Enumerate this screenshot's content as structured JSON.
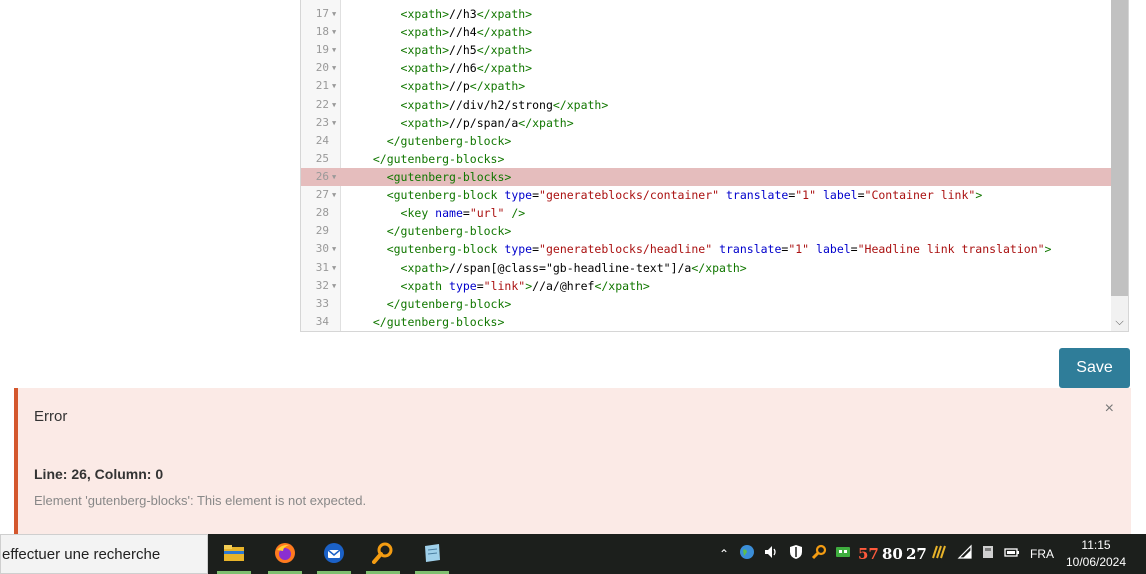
{
  "editor": {
    "lines": [
      {
        "num": "17",
        "fold": true,
        "error": false,
        "tokens": [
          [
            "x",
            "      "
          ],
          [
            "t",
            "<xpath>"
          ],
          [
            "x",
            "//h3"
          ],
          [
            "t",
            "</xpath>"
          ]
        ]
      },
      {
        "num": "18",
        "fold": true,
        "error": false,
        "tokens": [
          [
            "x",
            "      "
          ],
          [
            "t",
            "<xpath>"
          ],
          [
            "x",
            "//h4"
          ],
          [
            "t",
            "</xpath>"
          ]
        ]
      },
      {
        "num": "19",
        "fold": true,
        "error": false,
        "tokens": [
          [
            "x",
            "      "
          ],
          [
            "t",
            "<xpath>"
          ],
          [
            "x",
            "//h5"
          ],
          [
            "t",
            "</xpath>"
          ]
        ]
      },
      {
        "num": "20",
        "fold": true,
        "error": false,
        "tokens": [
          [
            "x",
            "      "
          ],
          [
            "t",
            "<xpath>"
          ],
          [
            "x",
            "//h6"
          ],
          [
            "t",
            "</xpath>"
          ]
        ]
      },
      {
        "num": "21",
        "fold": true,
        "error": false,
        "tokens": [
          [
            "x",
            "      "
          ],
          [
            "t",
            "<xpath>"
          ],
          [
            "x",
            "//p"
          ],
          [
            "t",
            "</xpath>"
          ]
        ]
      },
      {
        "num": "22",
        "fold": true,
        "error": false,
        "tokens": [
          [
            "x",
            "      "
          ],
          [
            "t",
            "<xpath>"
          ],
          [
            "x",
            "//div/h2/strong"
          ],
          [
            "t",
            "</xpath>"
          ]
        ]
      },
      {
        "num": "23",
        "fold": true,
        "error": false,
        "tokens": [
          [
            "x",
            "      "
          ],
          [
            "t",
            "<xpath>"
          ],
          [
            "x",
            "//p/span/a"
          ],
          [
            "t",
            "</xpath>"
          ]
        ]
      },
      {
        "num": "24",
        "fold": false,
        "error": false,
        "tokens": [
          [
            "x",
            "    "
          ],
          [
            "t",
            "</gutenberg-block>"
          ]
        ]
      },
      {
        "num": "25",
        "fold": false,
        "error": false,
        "tokens": [
          [
            "x",
            "  "
          ],
          [
            "t",
            "</gutenberg-blocks>"
          ]
        ]
      },
      {
        "num": "26",
        "fold": true,
        "error": true,
        "tokens": [
          [
            "x",
            "    "
          ],
          [
            "t",
            "<gutenberg-blocks>"
          ]
        ]
      },
      {
        "num": "27",
        "fold": true,
        "error": false,
        "tokens": [
          [
            "x",
            "    "
          ],
          [
            "t",
            "<gutenberg-block "
          ],
          [
            "a",
            "type"
          ],
          [
            "x",
            "="
          ],
          [
            "s",
            "\"generateblocks/container\""
          ],
          [
            "x",
            " "
          ],
          [
            "a",
            "translate"
          ],
          [
            "x",
            "="
          ],
          [
            "s",
            "\"1\""
          ],
          [
            "x",
            " "
          ],
          [
            "a",
            "label"
          ],
          [
            "x",
            "="
          ],
          [
            "s",
            "\"Container link\""
          ],
          [
            "t",
            ">"
          ]
        ]
      },
      {
        "num": "28",
        "fold": false,
        "error": false,
        "tokens": [
          [
            "x",
            "      "
          ],
          [
            "t",
            "<key "
          ],
          [
            "a",
            "name"
          ],
          [
            "x",
            "="
          ],
          [
            "s",
            "\"url\""
          ],
          [
            "x",
            " "
          ],
          [
            "t",
            "/>"
          ]
        ]
      },
      {
        "num": "29",
        "fold": false,
        "error": false,
        "tokens": [
          [
            "x",
            "    "
          ],
          [
            "t",
            "</gutenberg-block>"
          ]
        ]
      },
      {
        "num": "30",
        "fold": true,
        "error": false,
        "tokens": [
          [
            "x",
            "    "
          ],
          [
            "t",
            "<gutenberg-block "
          ],
          [
            "a",
            "type"
          ],
          [
            "x",
            "="
          ],
          [
            "s",
            "\"generateblocks/headline\""
          ],
          [
            "x",
            " "
          ],
          [
            "a",
            "translate"
          ],
          [
            "x",
            "="
          ],
          [
            "s",
            "\"1\""
          ],
          [
            "x",
            " "
          ],
          [
            "a",
            "label"
          ],
          [
            "x",
            "="
          ],
          [
            "s",
            "\"Headline link translation\""
          ],
          [
            "t",
            ">"
          ]
        ]
      },
      {
        "num": "31",
        "fold": true,
        "error": false,
        "tokens": [
          [
            "x",
            "      "
          ],
          [
            "t",
            "<xpath>"
          ],
          [
            "x",
            "//span[@class=\"gb-headline-text\"]/a"
          ],
          [
            "t",
            "</xpath>"
          ]
        ]
      },
      {
        "num": "32",
        "fold": true,
        "error": false,
        "tokens": [
          [
            "x",
            "      "
          ],
          [
            "t",
            "<xpath "
          ],
          [
            "a",
            "type"
          ],
          [
            "x",
            "="
          ],
          [
            "s",
            "\"link\""
          ],
          [
            "t",
            ">"
          ],
          [
            "x",
            "//a/@href"
          ],
          [
            "t",
            "</xpath>"
          ]
        ]
      },
      {
        "num": "33",
        "fold": false,
        "error": false,
        "tokens": [
          [
            "x",
            "    "
          ],
          [
            "t",
            "</gutenberg-block>"
          ]
        ]
      },
      {
        "num": "34",
        "fold": false,
        "error": false,
        "tokens": [
          [
            "x",
            "  "
          ],
          [
            "t",
            "</gutenberg-blocks>"
          ]
        ]
      }
    ]
  },
  "save_label": "Save",
  "error": {
    "title": "Error",
    "close": "×",
    "location": "Line: 26, Column: 0",
    "message": "Element 'gutenberg-blocks': This element is not expected."
  },
  "taskbar": {
    "search_text": "effectuer une recherche",
    "apps": [
      {
        "name": "file-explorer-icon",
        "color": "#f0c02c"
      },
      {
        "name": "firefox-icon",
        "color": "#e8541c"
      },
      {
        "name": "thunderbird-icon",
        "color": "#1f6fd6"
      },
      {
        "name": "search-tool-icon",
        "color": "#f39c12"
      },
      {
        "name": "notepad-icon",
        "color": "#8fc3e0"
      }
    ],
    "tray_badges": [
      "57",
      "80",
      "27"
    ],
    "language": "FRA",
    "time": "11:15",
    "date": "10/06/2024"
  }
}
